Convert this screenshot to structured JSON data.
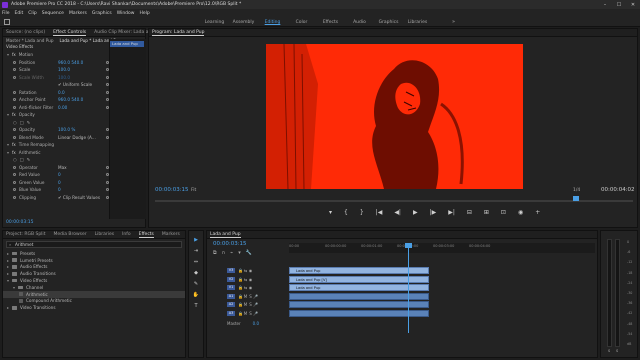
{
  "window": {
    "title": "Adobe Premiere Pro CC 2018 - C:\\Users\\Ravi Shankar\\Documents\\Adobe\\Premiere Pro\\12.0\\RGB Split *",
    "buttons": [
      "–",
      "☐",
      "✕"
    ]
  },
  "menu": [
    "File",
    "Edit",
    "Clip",
    "Sequence",
    "Markers",
    "Graphics",
    "Window",
    "Help"
  ],
  "workspaces": {
    "tabs": [
      "Learning",
      "Assembly",
      "Editing",
      "Color",
      "Effects",
      "Audio",
      "Graphics",
      "Libraries"
    ],
    "active": "Editing",
    "more": "»"
  },
  "effect_controls": {
    "tabs": [
      "Source: (no clips)",
      "Effect Controls",
      "Audio Clip Mixer: Lada and Pup"
    ],
    "active_tab": "Effect Controls",
    "header_master": "Master * Lada and Pup",
    "header_clip": "Lada and Pup * Lada and Pup",
    "mini_clip": "Lada and Pup",
    "section_video": "Video Effects",
    "rows": [
      {
        "label": "Motion",
        "indent": 1,
        "fx": true
      },
      {
        "label": "Position",
        "value": "960.0    540.0",
        "indent": 2
      },
      {
        "label": "Scale",
        "value": "100.0",
        "indent": 2
      },
      {
        "label": "Scale Width",
        "value": "100.0",
        "indent": 2,
        "dim": true
      },
      {
        "label": "",
        "value": "✔ Uniform Scale",
        "indent": 2,
        "check": true
      },
      {
        "label": "Rotation",
        "value": "0.0",
        "indent": 2
      },
      {
        "label": "Anchor Point",
        "value": "960.0    540.0",
        "indent": 2
      },
      {
        "label": "Anti-flicker Filter",
        "value": "0.00",
        "indent": 2
      },
      {
        "label": "Opacity",
        "indent": 1,
        "fx": true
      },
      {
        "label": "",
        "indent": 2,
        "shapes": true
      },
      {
        "label": "Opacity",
        "value": "100.0 %",
        "indent": 2
      },
      {
        "label": "Blend Mode",
        "value": "Linear Dodge (A...",
        "indent": 2,
        "plain": true
      },
      {
        "label": "Time Remapping",
        "indent": 1,
        "fx": true
      },
      {
        "label": "Arithmetic",
        "indent": 1,
        "fx": true
      },
      {
        "label": "",
        "indent": 2,
        "shapes": true
      },
      {
        "label": "Operator",
        "value": "Max",
        "indent": 2,
        "plain": true
      },
      {
        "label": "Red Value",
        "value": "0",
        "indent": 2
      },
      {
        "label": "Green Value",
        "value": "0",
        "indent": 2
      },
      {
        "label": "Blue Value",
        "value": "0",
        "indent": 2
      },
      {
        "label": "Clipping",
        "value": "✔ Clip Result Values",
        "indent": 2,
        "check": true
      }
    ],
    "timecode": "00:00:03:15"
  },
  "program": {
    "tab": "Program: Lada and Pup",
    "timecode_left": "00:00:03:15",
    "fit": "Fit",
    "quality": "1/4",
    "timecode_right": "00:00:04:02",
    "frame_color": "#ff2a06",
    "transport": [
      "▾",
      "{",
      "}",
      "|◀",
      "◀|",
      "▶",
      "|▶",
      "▶|",
      "⊟",
      "⊞",
      "⊡",
      "◉",
      "+"
    ],
    "playhead_fraction": 0.88
  },
  "project": {
    "tabs": [
      "Project: RGB Split",
      "Media Browser",
      "Libraries",
      "Info",
      "Effects",
      "Markers"
    ],
    "active_tab": "Effects",
    "search": "Arithmet",
    "tree": [
      {
        "label": "Presets",
        "level": 0
      },
      {
        "label": "Lumetri Presets",
        "level": 0
      },
      {
        "label": "Audio Effects",
        "level": 0
      },
      {
        "label": "Audio Transitions",
        "level": 0
      },
      {
        "label": "Video Effects",
        "level": 0,
        "open": true
      },
      {
        "label": "Channel",
        "level": 1,
        "open": true
      },
      {
        "label": "Arithmetic",
        "level": 2,
        "selected": true
      },
      {
        "label": "Compound Arithmetic",
        "level": 2
      },
      {
        "label": "Video Transitions",
        "level": 0
      }
    ]
  },
  "tools": [
    "▶",
    "⇥",
    "⇔",
    "◆",
    "✎",
    "✋",
    "T"
  ],
  "timeline": {
    "tab": "Lada and Pup",
    "timecode": "00:00:03:15",
    "ruler": [
      "00:00",
      "00:00:00:00",
      "00:00:01:00",
      "00:00:02:00",
      "00:00:03:00",
      "00:00:04:00"
    ],
    "tracks": [
      {
        "name": "V3",
        "type": "video",
        "clip": "Lada and Pup"
      },
      {
        "name": "V2",
        "type": "video",
        "clip": "Lada and Pup [V]"
      },
      {
        "name": "V1",
        "type": "video",
        "clip": "Lada and Pup"
      },
      {
        "name": "A1",
        "type": "audio",
        "clip": ""
      },
      {
        "name": "A2",
        "type": "audio",
        "clip": ""
      },
      {
        "name": "A3",
        "type": "audio",
        "clip": ""
      }
    ],
    "master": {
      "label": "Master",
      "value": "0.0"
    }
  },
  "meters": {
    "labels": [
      "0",
      "-6",
      "-12",
      "-18",
      "-24",
      "-30",
      "-36",
      "-42",
      "-48",
      "-54",
      "dB"
    ],
    "solo": [
      "S",
      "S"
    ]
  }
}
